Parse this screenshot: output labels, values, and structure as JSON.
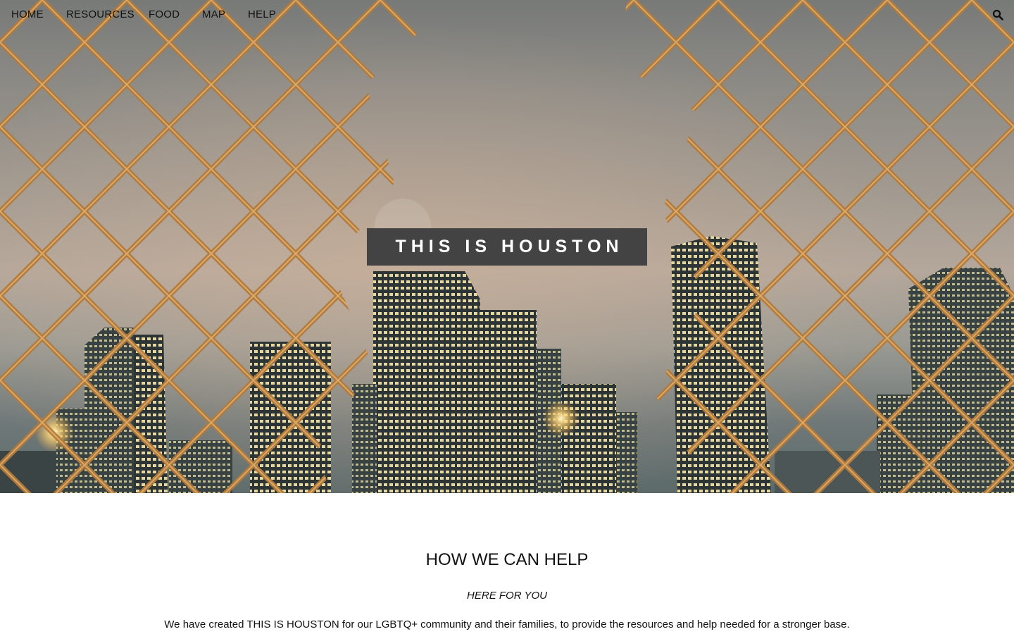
{
  "nav": {
    "items": [
      {
        "label": "HOME"
      },
      {
        "label": "RESOURCES"
      },
      {
        "label": "FOOD"
      },
      {
        "label": "MAP"
      },
      {
        "label": "HELP"
      }
    ],
    "search_icon": "search-icon"
  },
  "hero": {
    "title": "THIS IS HOUSTON",
    "image_subject": "Houston skyline at night seen through a torn chain-link fence"
  },
  "section": {
    "heading": "HOW WE CAN HELP",
    "subheading": "HERE FOR YOU",
    "body": "We have created THIS IS HOUSTON for our LGBTQ+ community and their families, to provide the resources and help needed for a stronger base."
  },
  "colors": {
    "title_box": "#434343",
    "fence": "#b07a3e",
    "text": "#111111"
  }
}
